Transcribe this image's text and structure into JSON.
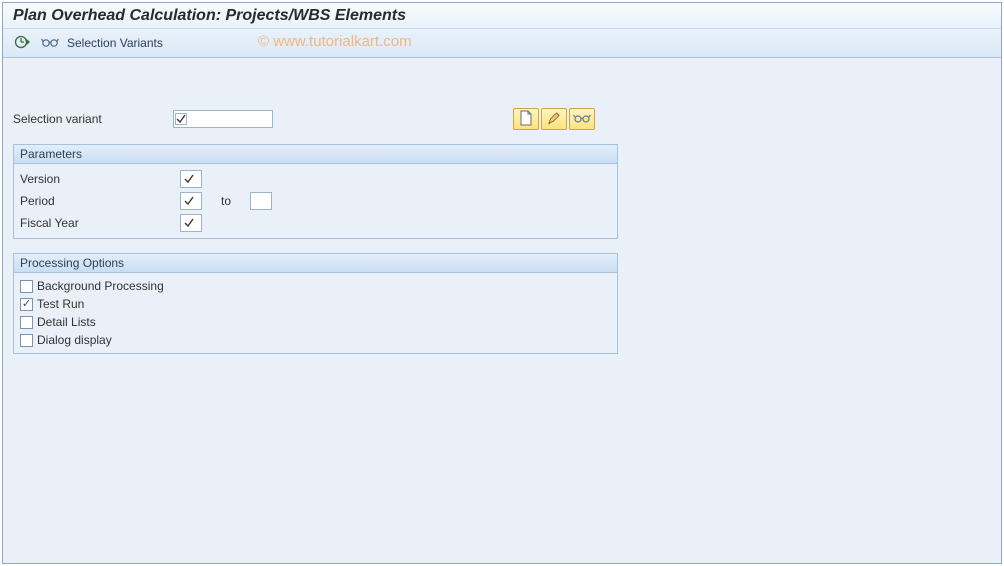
{
  "title": "Plan Overhead Calculation: Projects/WBS Elements",
  "watermark": "© www.tutorialkart.com",
  "toolbar": {
    "execute_tooltip": "Execute",
    "variants_label": "Selection Variants"
  },
  "selection_variant": {
    "label": "Selection variant",
    "value": "",
    "required": true
  },
  "variant_buttons": {
    "create_tooltip": "Create",
    "change_tooltip": "Change",
    "display_tooltip": "Display"
  },
  "parameters": {
    "header": "Parameters",
    "version": {
      "label": "Version",
      "value": "",
      "required": true
    },
    "period": {
      "label": "Period",
      "value": "",
      "required": true,
      "to_label": "to",
      "to_value": ""
    },
    "fiscal_year": {
      "label": "Fiscal Year",
      "value": "",
      "required": true
    }
  },
  "processing_options": {
    "header": "Processing Options",
    "items": [
      {
        "label": "Background Processing",
        "checked": false
      },
      {
        "label": "Test Run",
        "checked": true
      },
      {
        "label": "Detail Lists",
        "checked": false
      },
      {
        "label": "Dialog display",
        "checked": false
      }
    ]
  }
}
